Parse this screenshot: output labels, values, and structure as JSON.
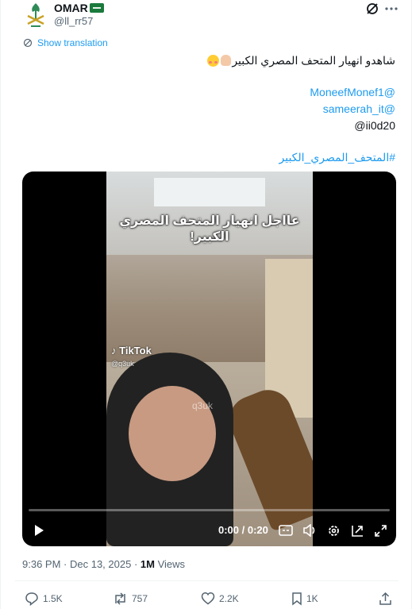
{
  "author": {
    "name": "OMAR",
    "handle": "@ll_rr57",
    "flag_icon": "saudi-flag-icon",
    "avatar_icon": "saudi-emblem-icon"
  },
  "translate_label": "Show translation",
  "tweet": {
    "text": "شاهدو انهيار المتحف المصري الكبير",
    "mention1": "@MoneefMonef1",
    "mention2": "@sameerah_it",
    "mention3": "ii0d20@",
    "hashtag": "#المتحف_المصري_الكبير"
  },
  "video": {
    "caption": "عااجل انهيار المتحف المصري الكبير!",
    "tiktok_label": "TikTok",
    "tiktok_user": "@q3uk",
    "watermark": "q3uk",
    "time": "0:00 / 0:20",
    "progress": 0
  },
  "meta": {
    "time": "9:36 PM",
    "date": "Dec 13, 2025",
    "views_count": "1M",
    "views_label": "Views"
  },
  "actions": {
    "replies": "1.5K",
    "reposts": "757",
    "likes": "2.2K",
    "bookmarks": "1K"
  },
  "colors": {
    "accent": "#1d9bf0",
    "secondary_text": "#536471",
    "primary_text": "#0f1419"
  }
}
